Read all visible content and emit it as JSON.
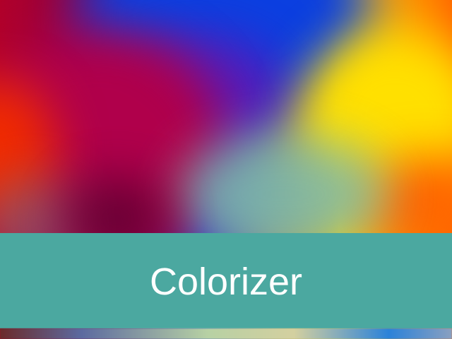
{
  "app": {
    "title": "Colorizer"
  },
  "theme": {
    "banner_color": "#4ba8a0",
    "text_color": "#ffffff"
  }
}
